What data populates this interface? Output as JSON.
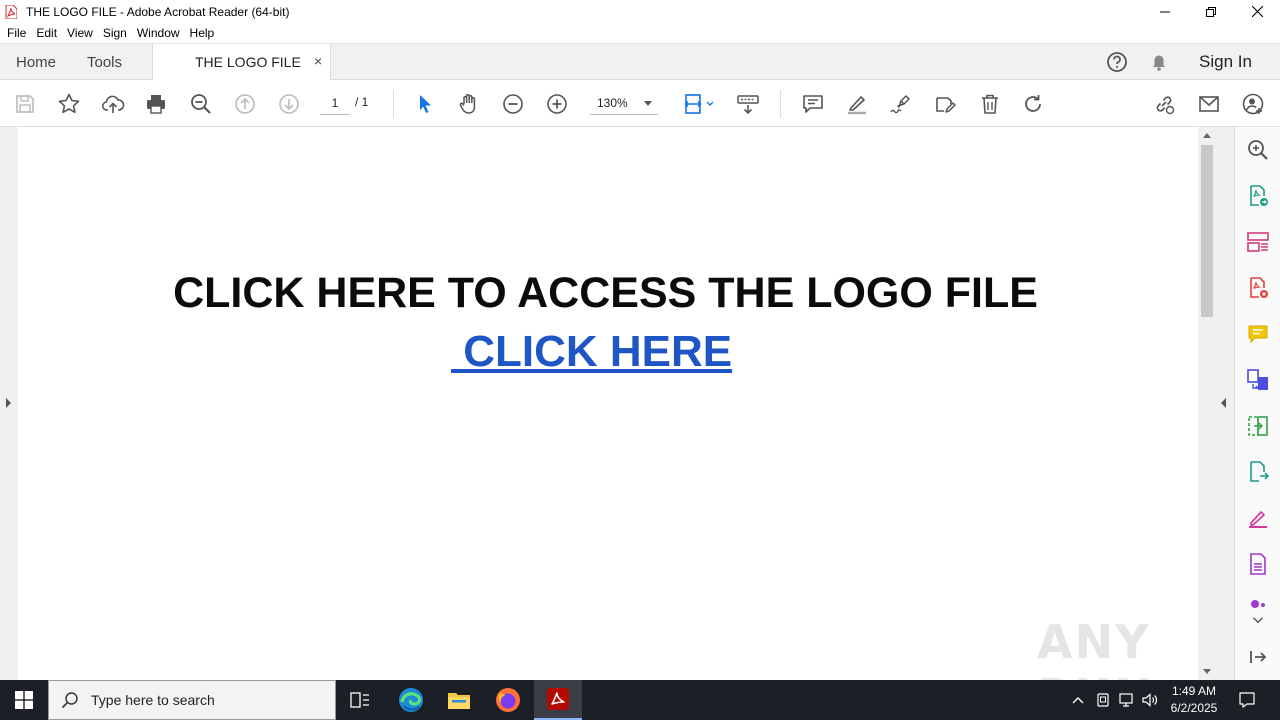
{
  "window": {
    "title": "THE LOGO FILE - Adobe Acrobat Reader (64-bit)"
  },
  "menu": [
    "File",
    "Edit",
    "View",
    "Sign",
    "Window",
    "Help"
  ],
  "tabs": {
    "home": "Home",
    "tools": "Tools",
    "document": "THE LOGO FILE",
    "close": "×",
    "sign_in": "Sign In"
  },
  "toolbar": {
    "page_current": "1",
    "page_total": "/ 1",
    "zoom": "130%"
  },
  "document": {
    "heading": "CLICK HERE TO ACCESS THE LOGO FILE",
    "link": " CLICK HERE"
  },
  "watermark": "ANY RUN",
  "taskbar": {
    "search_placeholder": "Type here to search",
    "time": "1:49 AM",
    "date": "6/2/2025"
  },
  "colors": {
    "link": "#1f56c7",
    "accent": "#1473e6",
    "taskbar": "#1c1f26"
  }
}
